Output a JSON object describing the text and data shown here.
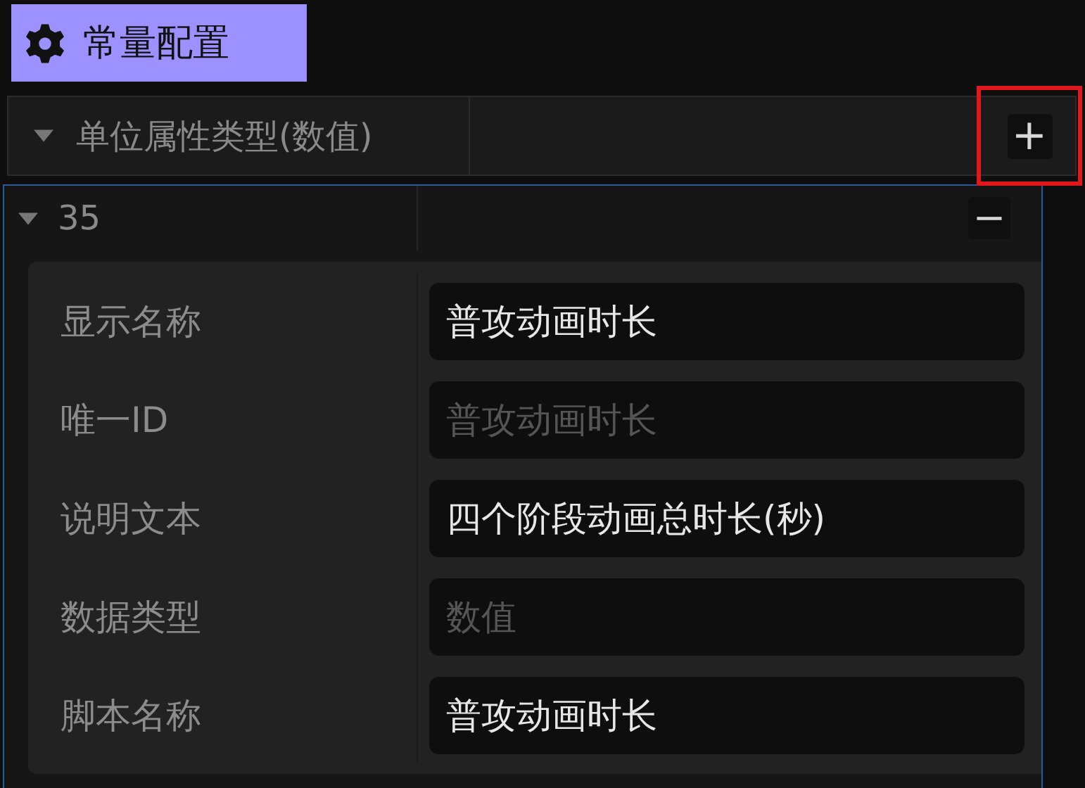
{
  "header_tab": {
    "title": "常量配置",
    "selected": true
  },
  "section": {
    "title": "单位属性类型(数值)",
    "expanded": true,
    "add_button": {
      "label": "+",
      "highlighted": true
    }
  },
  "entry": {
    "title": "35",
    "expanded": true,
    "remove_button": {
      "label": "−"
    },
    "fields": [
      {
        "label": "显示名称",
        "value": "普攻动画时长"
      },
      {
        "label": "唯一ID",
        "placeholder": "普攻动画时长"
      },
      {
        "label": "说明文本",
        "value": "四个阶段动画总时长(秒)"
      },
      {
        "label": "数据类型",
        "placeholder": "数值"
      },
      {
        "label": "脚本名称",
        "value": "普攻动画时长"
      }
    ]
  }
}
